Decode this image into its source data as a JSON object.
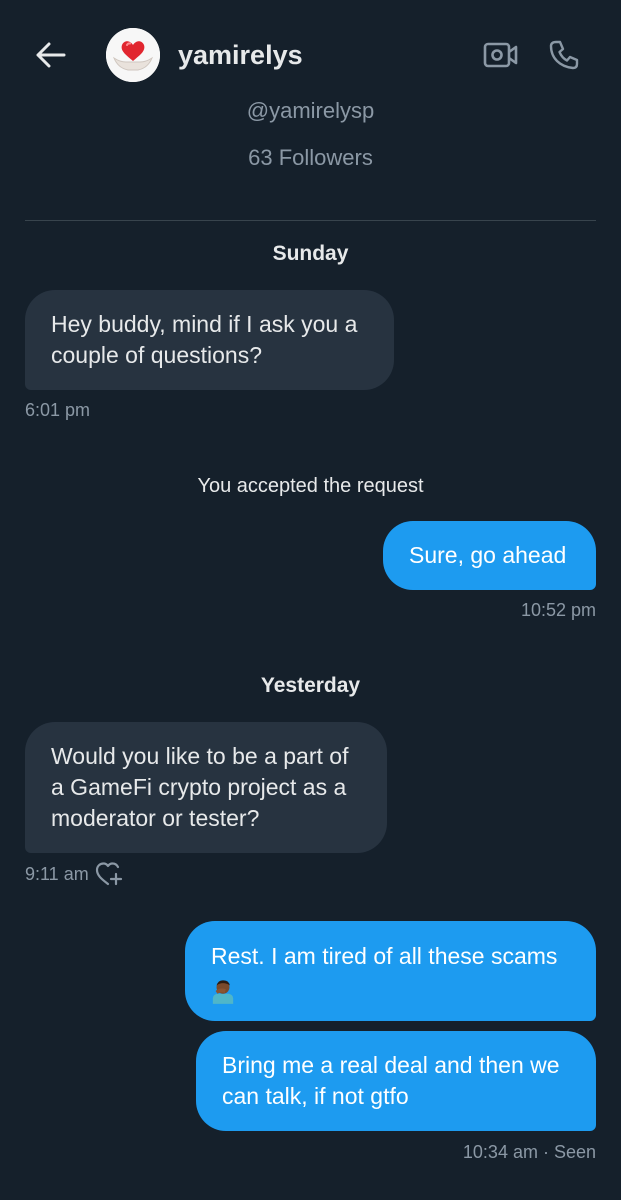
{
  "header": {
    "name": "yamirelys",
    "icons": {
      "back": "arrow-left-icon",
      "video": "video-call-icon",
      "phone": "phone-icon",
      "avatar": "heart-in-hands-avatar"
    }
  },
  "profile": {
    "handle": "@yamirelysp",
    "followers": "63 Followers"
  },
  "colors": {
    "background": "#15202b",
    "incoming_bubble": "#273340",
    "outgoing_bubble": "#1d9bf0",
    "muted_text": "#8b98a5"
  },
  "conversation": {
    "day1": "Sunday",
    "msg1": {
      "line1": "Hey buddy, mind if I ask you a",
      "line2": "couple of questions?",
      "time": "6:01 pm"
    },
    "system1": "You accepted the request",
    "msg2": {
      "text": "Sure, go ahead",
      "time": "10:52 pm"
    },
    "day2": "Yesterday",
    "msg3": {
      "line1": "Would you like to be a part of",
      "line2": "a GameFi crypto project as a",
      "line3": "moderator or tester?",
      "time": "9:11 am",
      "reaction_icon": "add-reaction-heart-icon"
    },
    "msg4": {
      "line1": "Rest. I am tired of all these scams",
      "emoji": "man-facepalming-emoji"
    },
    "msg5": {
      "line1": "Bring me a real deal and then we",
      "line2": "can talk, if not gtfo",
      "meta": "10:34 am · Seen"
    }
  }
}
